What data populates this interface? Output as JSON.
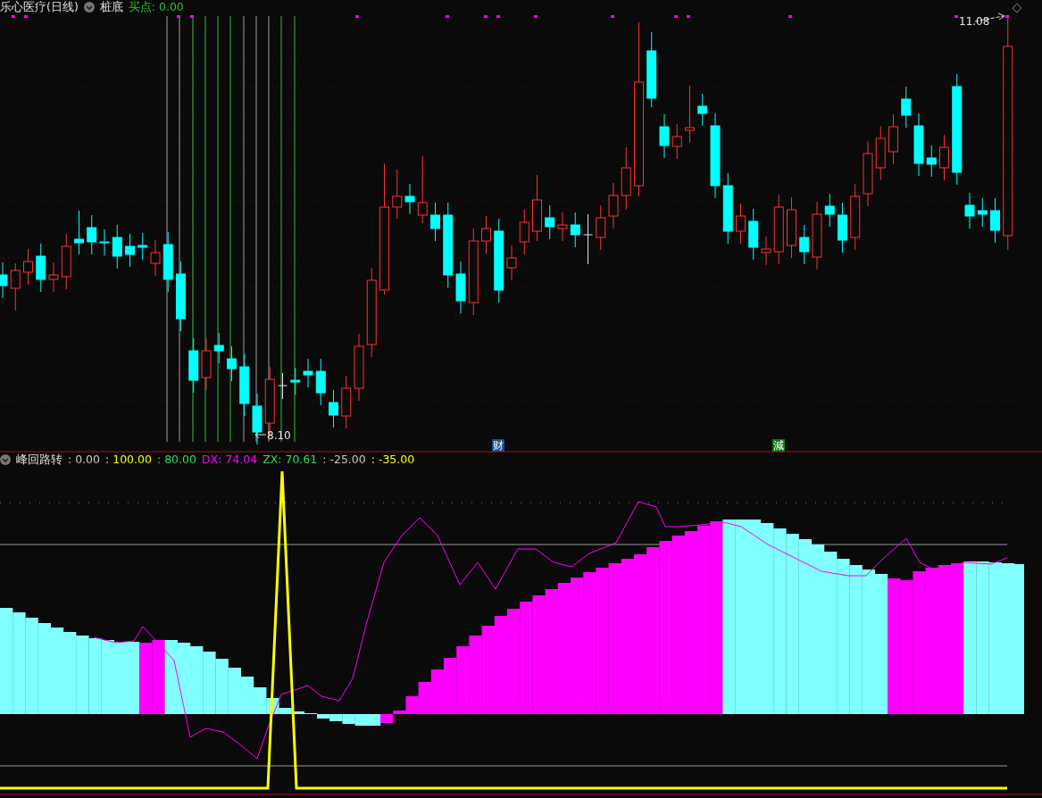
{
  "stock_title": "乐心医疗(日线)",
  "indicator_name": "桩底",
  "buy_point": {
    "label": "买点:",
    "value": "0.00"
  },
  "high_label": "11.08",
  "low_label": "8.10",
  "markers": [
    {
      "text": "财",
      "color": "#1c4f8c"
    },
    {
      "text": "減",
      "color": "#107a10"
    }
  ],
  "lower_panel": {
    "name": "峰回路转",
    "values": [
      {
        "text": ": 0.00",
        "color": "#c8c8c8"
      },
      {
        "text": ": 100.00",
        "color": "#ffff00"
      },
      {
        "text": ": 80.00",
        "color": "#20e060"
      },
      {
        "text": "DX: 74.04",
        "color": "#ff00ff"
      },
      {
        "text": "ZX: 70.61",
        "color": "#20e060"
      },
      {
        "text": ": -25.00",
        "color": "#c8c8c8"
      },
      {
        "text": ": -35.00",
        "color": "#ffff00"
      }
    ]
  }
}
